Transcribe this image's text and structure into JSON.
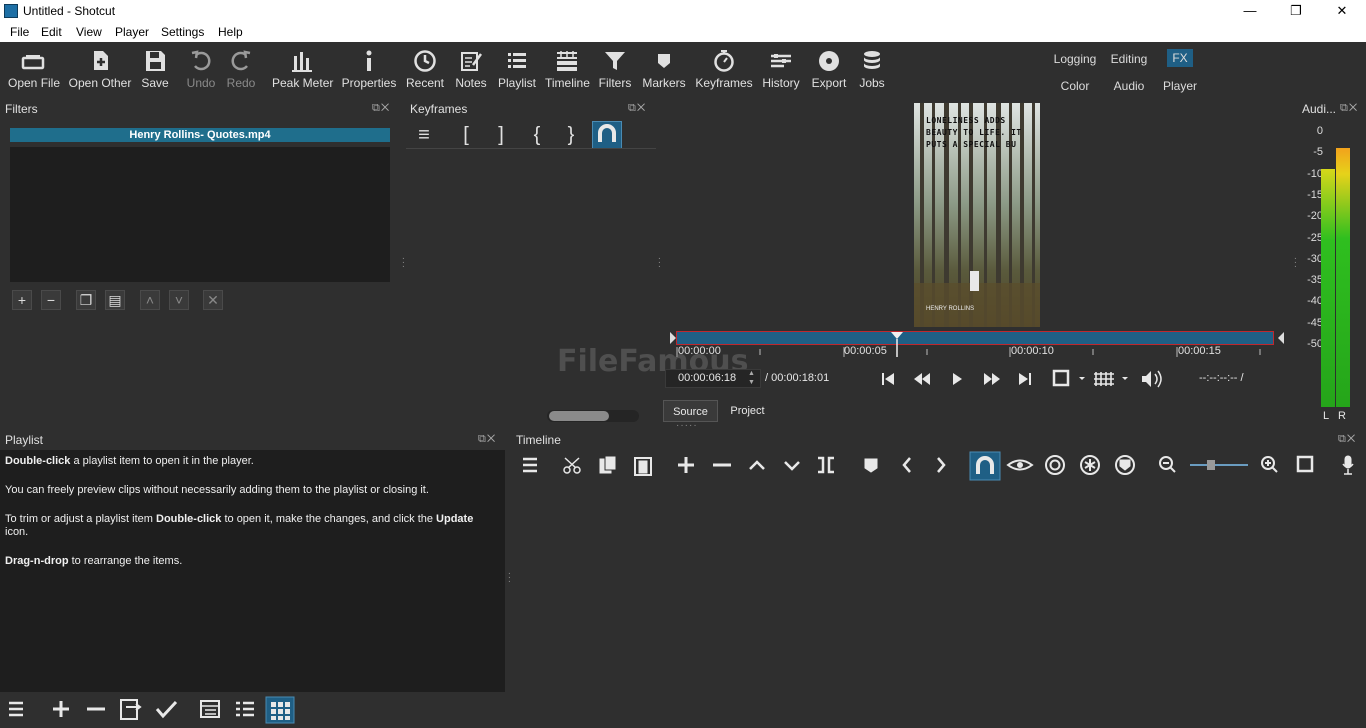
{
  "window": {
    "title": "Untitled - Shotcut",
    "minimize": "—",
    "maximize": "❐",
    "close": "✕"
  },
  "menu": [
    "File",
    "Edit",
    "View",
    "Player",
    "Settings",
    "Help"
  ],
  "toolbar": [
    {
      "label": "Open File",
      "icon": "open-file-icon"
    },
    {
      "label": "Open Other",
      "icon": "open-other-icon"
    },
    {
      "label": "Save",
      "icon": "save-icon"
    },
    {
      "label": "Undo",
      "icon": "undo-icon"
    },
    {
      "label": "Redo",
      "icon": "redo-icon"
    },
    {
      "label": "Peak Meter",
      "icon": "peak-meter-icon"
    },
    {
      "label": "Properties",
      "icon": "properties-icon"
    },
    {
      "label": "Recent",
      "icon": "recent-icon"
    },
    {
      "label": "Notes",
      "icon": "notes-icon"
    },
    {
      "label": "Playlist",
      "icon": "playlist-icon"
    },
    {
      "label": "Timeline",
      "icon": "timeline-icon"
    },
    {
      "label": "Filters",
      "icon": "filters-icon"
    },
    {
      "label": "Markers",
      "icon": "markers-icon"
    },
    {
      "label": "Keyframes",
      "icon": "keyframes-icon"
    },
    {
      "label": "History",
      "icon": "history-icon"
    },
    {
      "label": "Export",
      "icon": "export-icon"
    },
    {
      "label": "Jobs",
      "icon": "jobs-icon"
    }
  ],
  "layouts": {
    "logging": "Logging",
    "editing": "Editing",
    "fx": "FX",
    "color": "Color",
    "audio": "Audio",
    "player": "Player"
  },
  "filters": {
    "title": "Filters",
    "clip": "Henry Rollins- Quotes.mp4"
  },
  "keyframes": {
    "title": "Keyframes",
    "buttons": [
      "≡",
      "[",
      "]",
      "{",
      "}"
    ]
  },
  "preview": {
    "caption": "LONELINESS ADDS BEAUTY TO LIFE. IT PUTS A SPECIAL BU",
    "credit": "HENRY ROLLINS"
  },
  "player": {
    "ticks": [
      "00:00:00",
      "00:00:05",
      "00:00:10",
      "00:00:15"
    ],
    "timecode": "00:00:06:18",
    "duration": "/ 00:00:18:01",
    "in_out": "--:--:--:-- /",
    "tabs": [
      "Source",
      "Project"
    ],
    "position_fraction": 0.37
  },
  "audio": {
    "title": "Audi...",
    "scale": [
      "0",
      "-5",
      "-10",
      "-15",
      "-20",
      "-25",
      "-30",
      "-35",
      "-40",
      "-45",
      "-50"
    ],
    "left": "L",
    "right": "R"
  },
  "playlist": {
    "title": "Playlist",
    "p1_bold": "Double-click",
    "p1": " a playlist item to open it in the player.",
    "p2": "You can freely preview clips without necessarily adding them to the playlist or closing it.",
    "p3_a": "To trim or adjust a playlist item ",
    "p3_bold": "Double-click",
    "p3_b": " to open it, make the changes, and click the ",
    "p3_bold2": "Update",
    "p3_c": " icon.",
    "p4_bold": "Drag-n-drop",
    "p4": " to rearrange the items."
  },
  "timeline": {
    "title": "Timeline"
  },
  "watermark": "FileFamous",
  "colors": {
    "accent": "#1f6e8c",
    "scrubber": "#1f5f85",
    "in_marker": "#c0272d",
    "meter_green": "#2fbf1f",
    "meter_yellow": "#e6d21a"
  }
}
